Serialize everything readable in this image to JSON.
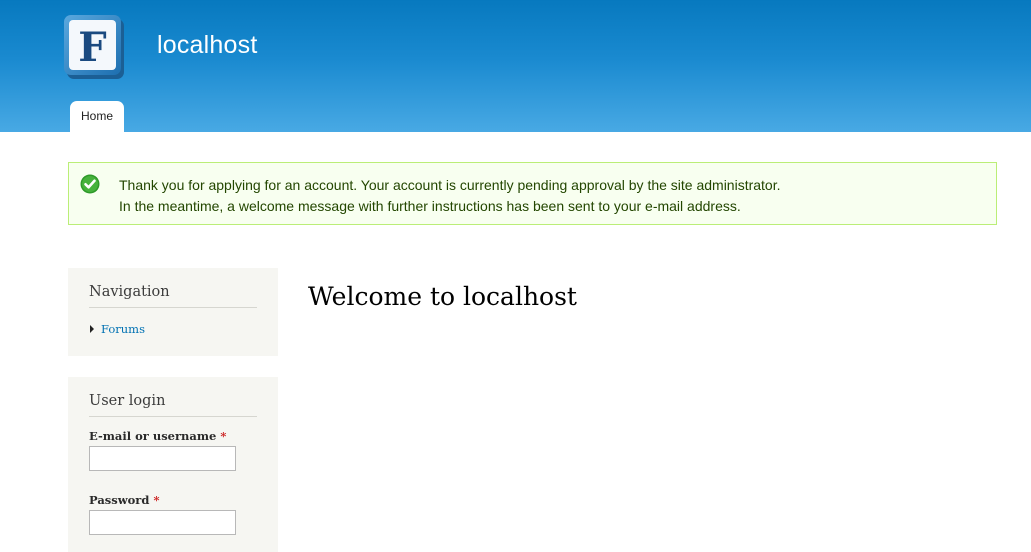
{
  "site": {
    "name": "localhost",
    "logo_letter": "F"
  },
  "tabs": [
    {
      "label": "Home",
      "active": true
    }
  ],
  "status_message": {
    "type": "status",
    "lines": [
      "Thank you for applying for an account. Your account is currently pending approval by the site administrator.",
      "In the meantime, a welcome message with further instructions has been sent to your e-mail address."
    ]
  },
  "sidebar": {
    "navigation": {
      "title": "Navigation",
      "items": [
        {
          "label": "Forums"
        }
      ]
    },
    "user_login": {
      "title": "User login",
      "username_label": "E-mail or username",
      "password_label": "Password",
      "required_marker": "*",
      "username_value": "",
      "password_value": ""
    }
  },
  "main": {
    "title": "Welcome to localhost"
  },
  "colors": {
    "header_top": "#0779bf",
    "header_bottom": "#48a9e4",
    "link": "#0071b3",
    "status_border": "#bbee77",
    "status_bg": "#f8fff0",
    "status_text": "#234600",
    "required": "#cc2222"
  },
  "icons": {
    "logo": "forum-logo-icon",
    "status": "check-circle-icon",
    "nav_bullet": "triangle-right-icon"
  }
}
